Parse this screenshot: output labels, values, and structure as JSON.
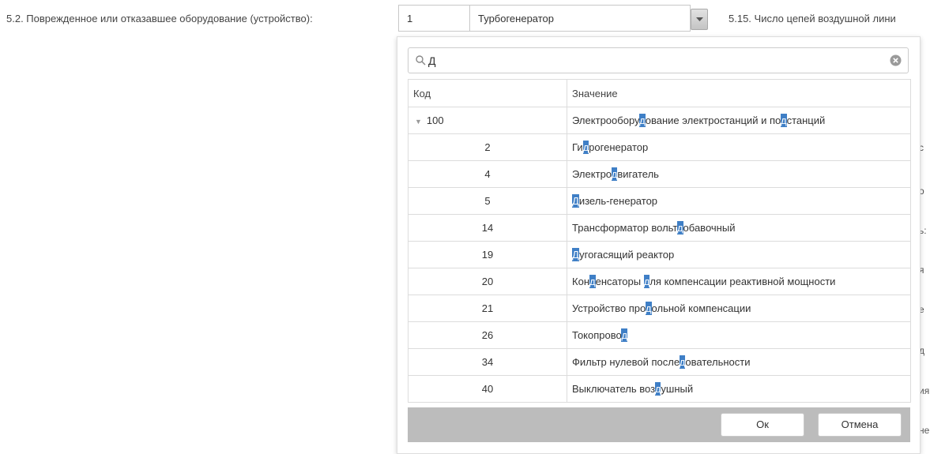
{
  "form": {
    "field_label": "5.2.  Поврежденное или отказавшее оборудование (устройство):",
    "code_value": "1",
    "value_text": "Турбогенератор",
    "right_label": "5.15. Число цепей воздушной лини",
    "background_fragments": [
      "с",
      "о",
      "ь:",
      "я",
      "е",
      "д",
      "ия",
      "не"
    ]
  },
  "dropdown": {
    "search_query": "Д",
    "highlight_char": "д",
    "columns": {
      "code": "Код",
      "value": "Значение"
    },
    "rows": [
      {
        "code": "100",
        "value": "Электрооборудование электростанций и подстанций",
        "parent": true,
        "expanded": true
      },
      {
        "code": "2",
        "value": "Гидрогенератор"
      },
      {
        "code": "4",
        "value": "Электродвигатель"
      },
      {
        "code": "5",
        "value": "Дизель-генератор"
      },
      {
        "code": "14",
        "value": "Трансформатор вольтдобавочный"
      },
      {
        "code": "19",
        "value": "Дугогасящий реактор"
      },
      {
        "code": "20",
        "value": "Конденсаторы для компенсации реактивной мощности"
      },
      {
        "code": "21",
        "value": "Устройство продольной компенсации"
      },
      {
        "code": "26",
        "value": "Токопровод"
      },
      {
        "code": "34",
        "value": "Фильтр нулевой последовательности"
      },
      {
        "code": "40",
        "value": "Выключатель воздушный"
      }
    ],
    "ok_label": "Ок",
    "cancel_label": "Отмена"
  },
  "colors": {
    "highlight": "#3f7fc6",
    "footer": "#bcbcbc"
  }
}
